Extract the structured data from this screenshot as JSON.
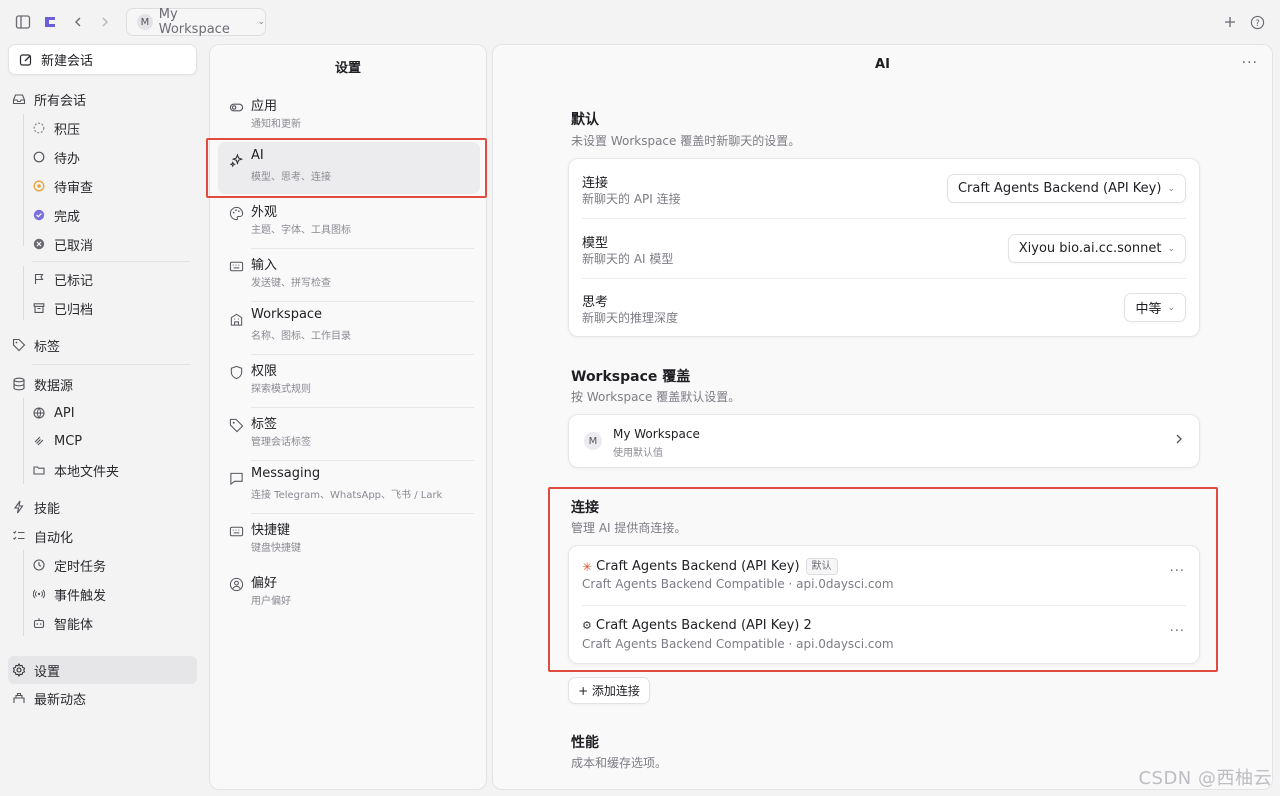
{
  "topbar": {
    "workspace_initial": "M",
    "workspace_name": "My Workspace"
  },
  "sidebar": {
    "new_chat": "新建会话",
    "all_chats": "所有会话",
    "status_items": [
      "积压",
      "待办",
      "待审查",
      "完成",
      "已取消"
    ],
    "flagged": "已标记",
    "archived": "已归档",
    "labels": "标签",
    "data_sources": "数据源",
    "source_items": [
      "API",
      "MCP",
      "本地文件夹"
    ],
    "skills": "技能",
    "automation": "自动化",
    "automation_items": [
      "定时任务",
      "事件触发",
      "智能体"
    ],
    "settings": "设置",
    "whats_new": "最新动态"
  },
  "settings_panel": {
    "title": "设置",
    "items": [
      {
        "title": "应用",
        "sub": "通知和更新"
      },
      {
        "title": "AI",
        "sub": "模型、思考、连接"
      },
      {
        "title": "外观",
        "sub": "主题、字体、工具图标"
      },
      {
        "title": "输入",
        "sub": "发送键、拼写检查"
      },
      {
        "title": "Workspace",
        "sub": "名称、图标、工作目录"
      },
      {
        "title": "权限",
        "sub": "探索模式规则"
      },
      {
        "title": "标签",
        "sub": "管理会话标签"
      },
      {
        "title": "Messaging",
        "sub": "连接 Telegram、WhatsApp、飞书 / Lark"
      },
      {
        "title": "快捷键",
        "sub": "键盘快捷键"
      },
      {
        "title": "偏好",
        "sub": "用户偏好"
      }
    ]
  },
  "main": {
    "title": "AI",
    "defaults": {
      "title": "默认",
      "sub": "未设置 Workspace 覆盖时新聊天的设置。",
      "rows": [
        {
          "title": "连接",
          "sub": "新聊天的 API 连接",
          "value": "Craft Agents Backend (API Key)"
        },
        {
          "title": "模型",
          "sub": "新聊天的 AI 模型",
          "value": "Xiyou bio.ai.cc.sonnet"
        },
        {
          "title": "思考",
          "sub": "新聊天的推理深度",
          "value": "中等"
        }
      ]
    },
    "override": {
      "title": "Workspace 覆盖",
      "sub": "按 Workspace 覆盖默认设置。",
      "workspace_initial": "M",
      "workspace_name": "My Workspace",
      "workspace_sub": "使用默认值"
    },
    "connections": {
      "title": "连接",
      "sub": "管理 AI 提供商连接。",
      "items": [
        {
          "name": "Craft Agents Backend (API Key)",
          "badge": "默认",
          "detail": "Craft Agents Backend Compatible · api.0daysci.com"
        },
        {
          "name": "Craft Agents Backend (API Key) 2",
          "detail": "Craft Agents Backend Compatible · api.0daysci.com"
        }
      ],
      "add_label": "+ 添加连接"
    },
    "performance": {
      "title": "性能",
      "sub": "成本和缓存选项。"
    }
  },
  "watermark": "CSDN @西柚云",
  "colors": {
    "accent": "#6b5fd6",
    "highlight_box": "#e04a3f",
    "pending": "#e9a23b",
    "done": "#7b6fe0"
  }
}
